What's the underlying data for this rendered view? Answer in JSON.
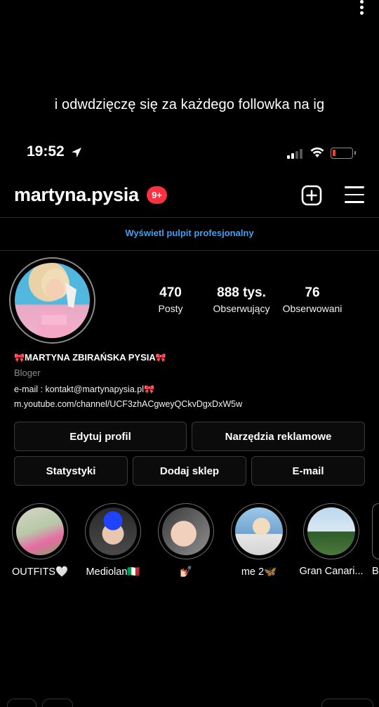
{
  "overlay": {
    "caption": "i odwdzięczę się za każdego followka na ig"
  },
  "status_bar": {
    "time": "19:52",
    "battery_level": 0.1,
    "battery_color": "#ff3b30"
  },
  "header": {
    "username": "martyna.pysia",
    "notification_badge": "9+",
    "badge_color": "#ff3040",
    "icons": [
      "new-post-icon",
      "menu-icon"
    ]
  },
  "pro_dashboard": {
    "label": "Wyświetl pulpit profesjonalny",
    "color": "#3ea0f5"
  },
  "stats": [
    {
      "value": "470",
      "label": "Posty"
    },
    {
      "value": "888 tys.",
      "label": "Obserwujący"
    },
    {
      "value": "76",
      "label": "Obserwowani"
    }
  ],
  "bio": {
    "name": "MARTYNA ZBIRAŃSKA PYSIA",
    "name_emoji": "🎀",
    "category": "Bloger",
    "email_line": "e-mail : kontakt@martynapysia.pl",
    "link": "m.youtube.com/channel/UCF3zhACgweyQCkvDgxDxW5w"
  },
  "buttons": {
    "row1": [
      "Edytuj profil",
      "Narzędzia reklamowe"
    ],
    "row2": [
      "Statystyki",
      "Dodaj sklep",
      "E-mail"
    ]
  },
  "highlights": [
    {
      "label": "OUTFITS🤍"
    },
    {
      "label": "Mediolan🇮🇹"
    },
    {
      "label": "💅🏻"
    },
    {
      "label": "me 2🦋"
    },
    {
      "label": "Gran Canari..."
    },
    {
      "label": "B"
    }
  ]
}
